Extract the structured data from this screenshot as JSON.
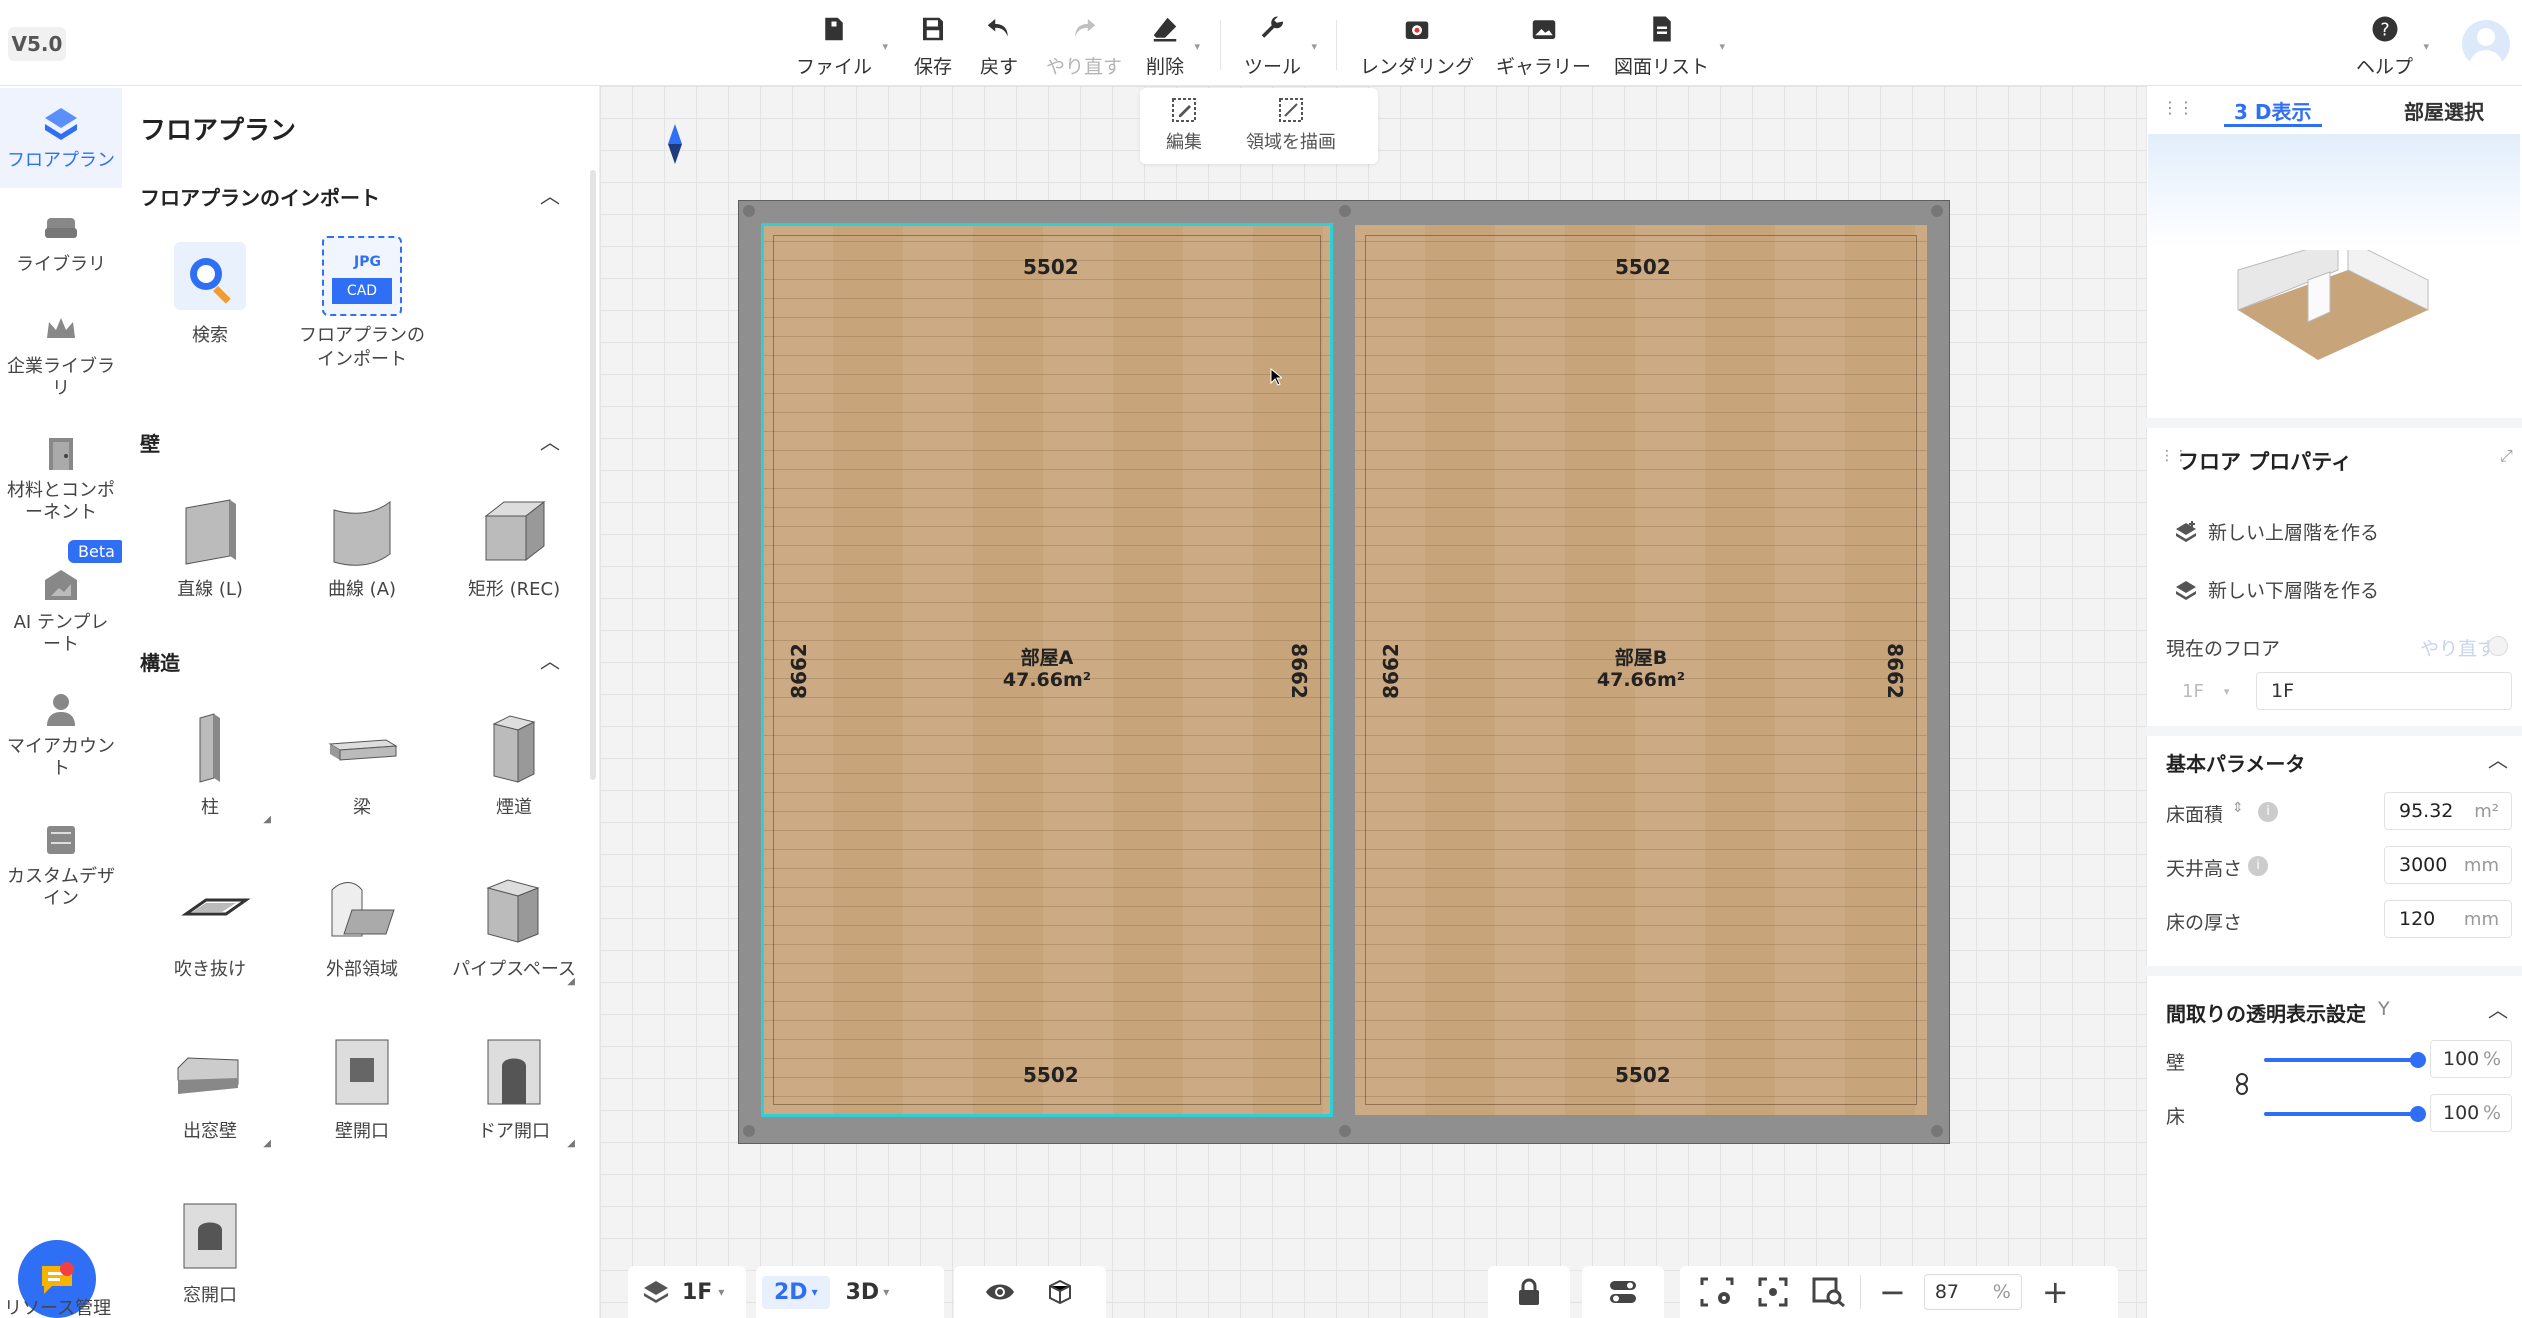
{
  "app": {
    "version": "V5.0"
  },
  "toolbar": {
    "file": "ファイル",
    "save": "保存",
    "undo": "戻す",
    "redo": "やり直す",
    "delete": "削除",
    "tools": "ツール",
    "rendering": "レンダリング",
    "gallery": "ギャラリー",
    "drawing_list": "図面リスト",
    "help": "ヘルプ"
  },
  "nav": {
    "floorplan": "フロアプラン",
    "library": "ライブラリ",
    "enterprise_library": "企業ライブラリ",
    "materials": "材料とコンポーネント",
    "ai_template": "AI テンプレート",
    "beta": "Beta",
    "my_account": "マイアカウント",
    "custom_design": "カスタムデザイン",
    "bottom_label": "リソース管理"
  },
  "panel": {
    "title": "フロアプラン",
    "import_section": "フロアプランのインポート",
    "search": "検索",
    "import_label": "フロアプランのインポート",
    "jpg": "JPG",
    "cad": "CAD",
    "wall_section": "壁",
    "wall_line": "直線 (L)",
    "wall_curve": "曲線 (A)",
    "wall_rect": "矩形 (REC)",
    "struct_section": "構造",
    "column": "柱",
    "beam": "梁",
    "chimney": "煙道",
    "void": "吹き抜け",
    "exterior": "外部領域",
    "pipe_space": "パイプスペース",
    "bay_window": "出窓壁",
    "wall_opening": "壁開口",
    "door_opening": "ドア開口",
    "window_opening": "窓開口"
  },
  "canvas": {
    "edit": "編集",
    "draw_area": "領域を描画",
    "rooms": [
      {
        "name": "部屋A",
        "area": "47.66m²",
        "top": "5502",
        "bottom": "5502",
        "left": "8662",
        "right": "8662"
      },
      {
        "name": "部屋B",
        "area": "47.66m²",
        "top": "5502",
        "bottom": "5502",
        "left": "8662",
        "right": "8662"
      }
    ]
  },
  "bottom": {
    "floor": "1F",
    "mode_2d": "2D",
    "mode_3d": "3D",
    "zoom": "87",
    "zoom_unit": "%"
  },
  "right": {
    "tab_3d": "3 D表示",
    "tab_room": "部屋選択",
    "props_title": "フロア プロパティ",
    "new_upper": "新しい上層階を作る",
    "new_lower": "新しい下層階を作る",
    "current_floor": "現在のフロア",
    "redo": "やり直す",
    "floor_select": "1F",
    "floor_name": "1F",
    "basic_params": "基本パラメータ",
    "floor_area_label": "床面積",
    "floor_area": "95.32",
    "floor_area_unit": "m²",
    "ceiling_label": "天井高さ",
    "ceiling": "3000",
    "ceiling_unit": "mm",
    "thickness_label": "床の厚さ",
    "thickness": "120",
    "thickness_unit": "mm",
    "transparency_title": "間取りの透明表示設定",
    "transparency_key": "Y",
    "wall_label": "壁",
    "wall_pct": "100",
    "floor_label": "床",
    "floor_pct": "100",
    "pct_unit": "%"
  },
  "colors": {
    "accent": "#2e6ff6",
    "selection": "#2ecfd6",
    "floor_wood": "#c8a47a"
  }
}
